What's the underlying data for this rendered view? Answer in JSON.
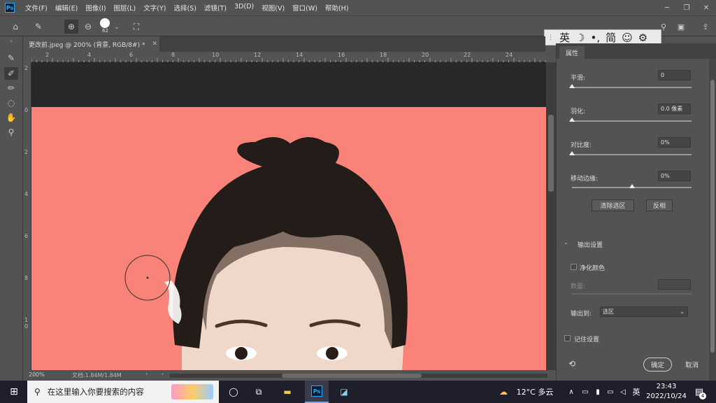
{
  "menubar": {
    "items": [
      "文件(F)",
      "编辑(E)",
      "图像(I)",
      "图层(L)",
      "文字(Y)",
      "选择(S)",
      "滤镜(T)",
      "3D(D)",
      "视图(V)",
      "窗口(W)",
      "帮助(H)"
    ],
    "app_logo": "Ps"
  },
  "options": {
    "brush_size": "62"
  },
  "ime": {
    "items": [
      "英",
      "☽",
      "•,",
      "简",
      "☺",
      "⚙"
    ]
  },
  "document": {
    "tab_title": "更改前.jpeg @ 200% (背景, RGB/8#) *",
    "zoom": "200%",
    "doc_info": "文档:1.84M/1.84M"
  },
  "rulers": {
    "h": [
      "2",
      "4",
      "6",
      "8",
      "10",
      "12",
      "14",
      "16",
      "18",
      "20",
      "22",
      "24"
    ],
    "v": [
      "2",
      "0",
      "2",
      "4",
      "6",
      "8",
      "1\n0"
    ]
  },
  "panel": {
    "tab": "属性",
    "smooth_label": "平滑:",
    "smooth_value": "0",
    "feather_label": "羽化:",
    "feather_value": "0.0 像素",
    "contrast_label": "对比度:",
    "contrast_value": "0%",
    "shift_edge_label": "移动边缘:",
    "shift_edge_value": "0%",
    "clear_selection": "清除选区",
    "invert": "反相",
    "output_settings": "输出设置",
    "decontaminate": "净化颜色",
    "amount_label": "数量:",
    "output_to_label": "输出到:",
    "output_to_value": "选区",
    "remember": "记住设置",
    "ok": "确定",
    "cancel": "取消",
    "smooth_level": 0,
    "feather_level": 0,
    "contrast_level": 0,
    "shift_edge_level": 0.5
  },
  "taskbar": {
    "search_placeholder": "在这里输入你要搜索的内容",
    "weather": "12°C 多云",
    "ime": "英",
    "time": "23:43",
    "date": "2022/10/24",
    "notif_count": "4"
  },
  "colors": {
    "background_fill": "#f98378",
    "ps_blue": "#31a8ff"
  }
}
